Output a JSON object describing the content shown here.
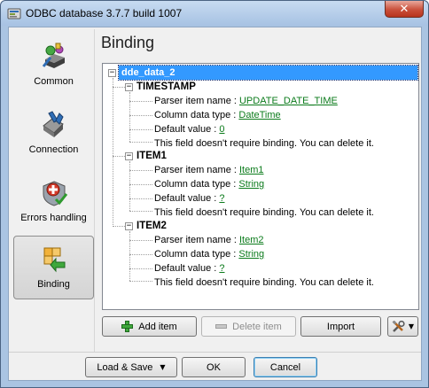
{
  "window": {
    "title": "ODBC database 3.7.7 build 1007",
    "close_symbol": "✕"
  },
  "nav": {
    "items": [
      {
        "label": "Common",
        "icon": "common-icon"
      },
      {
        "label": "Connection",
        "icon": "connection-icon"
      },
      {
        "label": "Errors handling",
        "icon": "errors-handling-icon"
      },
      {
        "label": "Binding",
        "icon": "binding-icon",
        "selected": true
      }
    ]
  },
  "page": {
    "title": "Binding"
  },
  "tree": {
    "root": "dde_data_2",
    "expander_symbol": "−",
    "groups": [
      {
        "name": "TIMESTAMP",
        "parser_label": "Parser item name : ",
        "parser_value": "UPDATE_DATE_TIME",
        "type_label": "Column data type : ",
        "type_value": "DateTime",
        "default_label": "Default value : ",
        "default_value": "0",
        "note": "This field doesn't require binding. You can delete it."
      },
      {
        "name": "ITEM1",
        "parser_label": "Parser item name : ",
        "parser_value": "Item1",
        "type_label": "Column data type : ",
        "type_value": "String",
        "default_label": "Default value : ",
        "default_value": "?",
        "note": "This field doesn't require binding. You can delete it."
      },
      {
        "name": "ITEM2",
        "parser_label": "Parser item name : ",
        "parser_value": "Item2",
        "type_label": "Column data type : ",
        "type_value": "String",
        "default_label": "Default value : ",
        "default_value": "?",
        "note": "This field doesn't require binding. You can delete it."
      }
    ]
  },
  "toolbar": {
    "add_label": "Add item",
    "delete_label": "Delete item",
    "import_label": "Import",
    "tools_icon": "tools-icon",
    "caret": "▼"
  },
  "footer": {
    "load_save_label": "Load & Save",
    "ok_label": "OK",
    "cancel_label": "Cancel",
    "caret": "▼"
  },
  "colors": {
    "selection": "#3399ff",
    "link": "#0b7b1b",
    "title_gradient_top": "#c7dbf1",
    "close_red": "#c9503b"
  }
}
